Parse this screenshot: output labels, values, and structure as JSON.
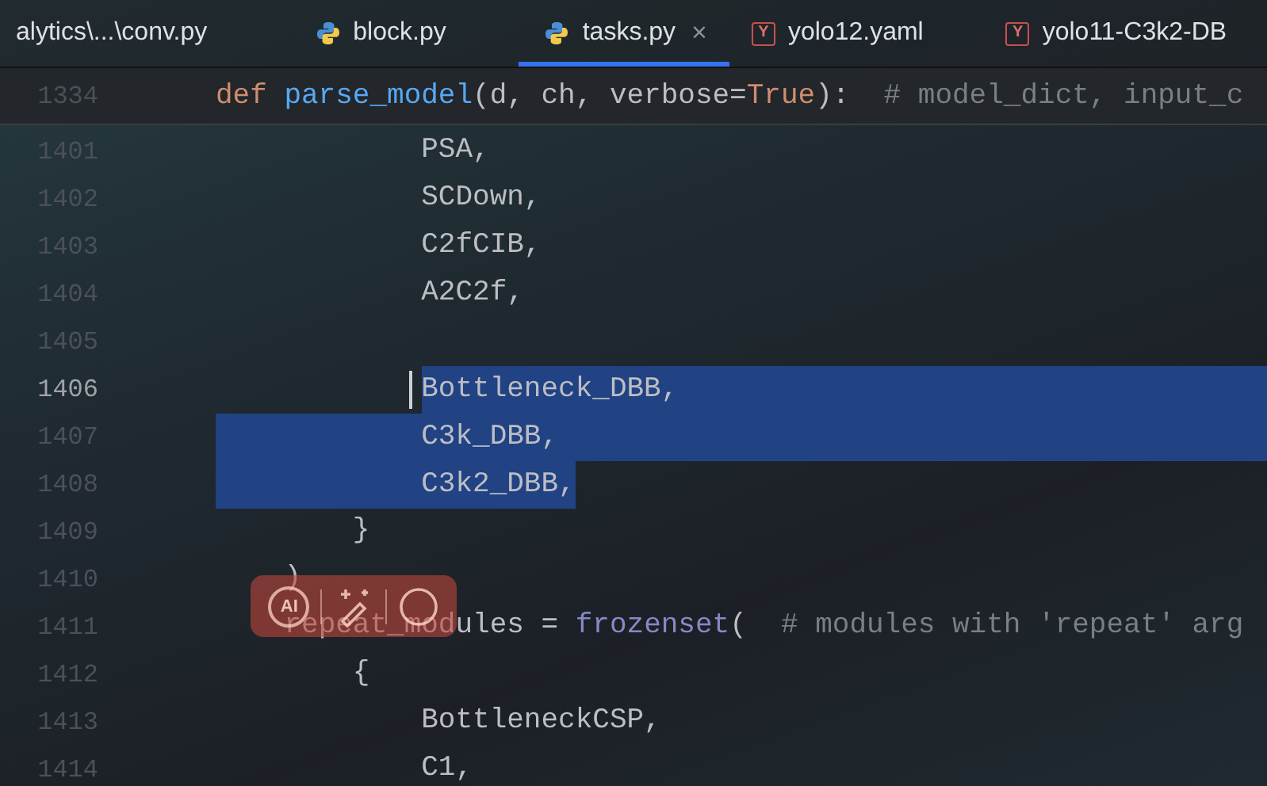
{
  "tabs": [
    {
      "label": "alytics\\...\\conv.py",
      "kind": "plain",
      "selected": false
    },
    {
      "label": "block.py",
      "kind": "python",
      "selected": false
    },
    {
      "label": "tasks.py",
      "kind": "python",
      "selected": true,
      "close": "×"
    },
    {
      "label": "yolo12.yaml",
      "kind": "yaml",
      "icon_letter": "Y",
      "selected": false
    },
    {
      "label": "yolo11-C3k2-DB",
      "kind": "yaml",
      "icon_letter": "Y",
      "selected": false
    }
  ],
  "sticky_line": {
    "number": "1334",
    "tokens": [
      {
        "text": "def",
        "kind": "keyword"
      },
      {
        "text": " parse_model",
        "kind": "function"
      },
      {
        "text": "(d, ch, verbose=",
        "kind": "plain"
      },
      {
        "text": "True",
        "kind": "keyword"
      },
      {
        "text": "):  # model_dict, input_c",
        "kind": "plaincomment"
      }
    ]
  },
  "lines": [
    {
      "number": "1401",
      "current": false,
      "eol_selected": false,
      "tokens": [
        {
          "text": "            PSA,",
          "kind": "plain",
          "selected": false
        }
      ]
    },
    {
      "number": "1402",
      "current": false,
      "eol_selected": false,
      "tokens": [
        {
          "text": "            SCDown,",
          "kind": "plain",
          "selected": false
        }
      ]
    },
    {
      "number": "1403",
      "current": false,
      "eol_selected": false,
      "tokens": [
        {
          "text": "            C2fCIB,",
          "kind": "plain",
          "selected": false
        }
      ]
    },
    {
      "number": "1404",
      "current": false,
      "eol_selected": false,
      "tokens": [
        {
          "text": "            A2C2f,",
          "kind": "plain",
          "selected": false
        }
      ]
    },
    {
      "number": "1405",
      "current": false,
      "eol_selected": false
    },
    {
      "number": "1406",
      "current": true,
      "eol_selected": true,
      "caret": true,
      "tokens": [
        {
          "text": "            Bottleneck_DBB,",
          "kind": "plain",
          "selected": true,
          "indent_selected": false
        }
      ]
    },
    {
      "number": "1407",
      "current": false,
      "eol_selected": true,
      "tokens": [
        {
          "text": "            C3k_DBB,",
          "kind": "plain",
          "selected": true,
          "indent_selected": true
        }
      ]
    },
    {
      "number": "1408",
      "current": false,
      "eol_selected": false,
      "tokens": [
        {
          "text": "            C3k2_DBB,",
          "kind": "plain",
          "selected": true,
          "indent_selected": true
        }
      ]
    },
    {
      "number": "1409",
      "current": false,
      "eol_selected": false,
      "tokens": [
        {
          "text": "        }",
          "kind": "plain",
          "selected": false
        }
      ]
    },
    {
      "number": "1410",
      "current": false,
      "eol_selected": false,
      "tokens": [
        {
          "text": "    )",
          "kind": "plain",
          "selected": false
        }
      ]
    },
    {
      "number": "1411",
      "current": false,
      "eol_selected": false,
      "tokens": [
        {
          "text": "    repeat_modules = ",
          "kind": "plain",
          "selected": false
        },
        {
          "text": "frozenset",
          "kind": "builtin",
          "selected": false
        },
        {
          "text": "(  ",
          "kind": "plain",
          "selected": false
        },
        {
          "text": "# modules with 'repeat' arg",
          "kind": "comment",
          "selected": false
        }
      ]
    },
    {
      "number": "1412",
      "current": false,
      "eol_selected": false,
      "tokens": [
        {
          "text": "        {",
          "kind": "plain",
          "selected": false
        }
      ]
    },
    {
      "number": "1413",
      "current": false,
      "eol_selected": false,
      "tokens": [
        {
          "text": "            BottleneckCSP,",
          "kind": "plain",
          "selected": false
        }
      ]
    },
    {
      "number": "1414",
      "current": false,
      "eol_selected": false,
      "tokens": [
        {
          "text": "            C1,",
          "kind": "plain",
          "selected": false
        }
      ]
    }
  ],
  "ai_toolbar": {
    "ai_label": "AI"
  }
}
